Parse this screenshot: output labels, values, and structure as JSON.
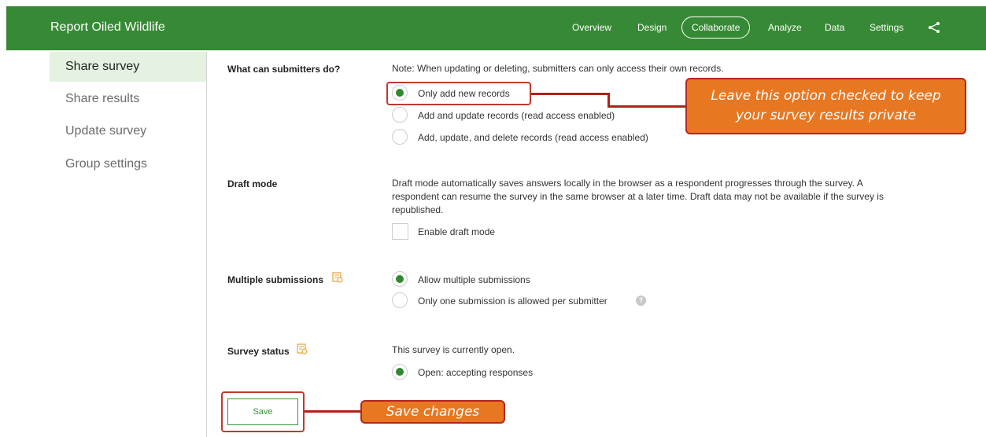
{
  "header": {
    "app_title": "Report Oiled Wildlife",
    "nav": [
      "Overview",
      "Design",
      "Collaborate",
      "Analyze",
      "Data",
      "Settings"
    ],
    "active_nav": "Collaborate",
    "share_icon": "share-icon"
  },
  "sidebar": {
    "items": [
      {
        "label": "Share survey",
        "active": true
      },
      {
        "label": "Share results",
        "active": false
      },
      {
        "label": "Update survey",
        "active": false
      },
      {
        "label": "Group settings",
        "active": false
      }
    ]
  },
  "submitters": {
    "label": "What can submitters do?",
    "note": "Note: When updating or deleting, submitters can only access their own records.",
    "options": [
      {
        "label": "Only add new records",
        "checked": true
      },
      {
        "label": "Add and update records (read access enabled)",
        "checked": false
      },
      {
        "label": "Add, update, and delete records (read access enabled)",
        "checked": false
      }
    ]
  },
  "draft": {
    "label": "Draft mode",
    "description_line1": "Draft mode automatically saves answers locally in the browser as a respondent progresses through the survey. A",
    "description_line2": "respondent can resume the survey in the same browser at a later time. Draft data may not be available if the survey is",
    "description_line3": "republished.",
    "checkbox_label": "Enable draft mode",
    "checked": false
  },
  "multiple": {
    "label": "Multiple submissions",
    "options": [
      {
        "label": "Allow multiple submissions",
        "checked": true
      },
      {
        "label": "Only one submission is allowed per submitter",
        "checked": false
      }
    ]
  },
  "status": {
    "label": "Survey status",
    "text": "This survey is currently open.",
    "option": "Open: accepting responses"
  },
  "save": {
    "label": "Save"
  },
  "callouts": {
    "option_callout_line1": "Leave this option checked to keep",
    "option_callout_line2": "your survey results private",
    "save_callout": "Save changes"
  },
  "colors": {
    "brand_green": "#378a35",
    "callout_orange": "#e87722",
    "callout_red": "#c0392b"
  }
}
